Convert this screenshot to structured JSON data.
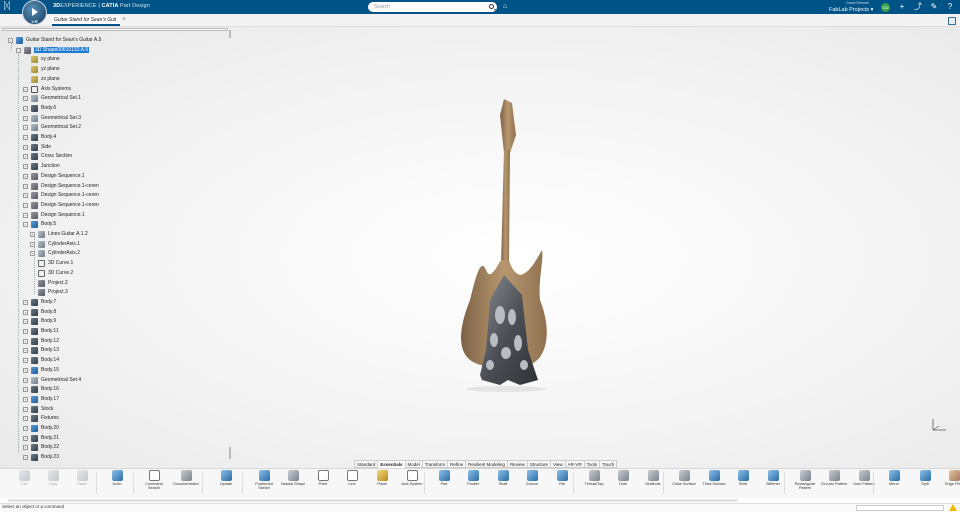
{
  "topbar": {
    "brand_bold": "3D",
    "brand_rest": "EXPERIENCE",
    "separator": " | ",
    "product": "CATIA",
    "app": " Part Design",
    "compass_version": "V.R",
    "search_placeholder": "Search",
    "user_name": "Grace Demuth",
    "workspace": "FabLab Projects",
    "workspace_chevron": "▾",
    "avatar_initials": "GD"
  },
  "tabs": {
    "active": "Guitar Stand for Sean's Guit",
    "add": "+"
  },
  "tree": {
    "root": "Guitar Stand for Sean's Guitar A.5",
    "part": "3D Shape00610133 A.5",
    "items": [
      {
        "label": "xy plane",
        "icon": "plane"
      },
      {
        "label": "yz plane",
        "icon": "plane"
      },
      {
        "label": "zx plane",
        "icon": "plane"
      },
      {
        "label": "Axis Systems",
        "icon": "axis"
      },
      {
        "label": "Geometrical Set.1",
        "icon": "geo"
      },
      {
        "label": "Body.6",
        "icon": "body"
      },
      {
        "label": "Geometrical Set.3",
        "icon": "geo"
      },
      {
        "label": "Geometrical Set.2",
        "icon": "geo"
      },
      {
        "label": "Body.4",
        "icon": "body"
      },
      {
        "label": "Side",
        "icon": "body"
      },
      {
        "label": "Cross Section",
        "icon": "body"
      },
      {
        "label": "Junction",
        "icon": "body"
      },
      {
        "label": "Design Sequence.1",
        "icon": "seq"
      },
      {
        "label": "Design Sequence.1-ceren",
        "icon": "seq"
      },
      {
        "label": "Design Sequence.1-ceren",
        "icon": "seq"
      },
      {
        "label": "Design Sequence.1-ceren",
        "icon": "seq"
      },
      {
        "label": "Design Sequence.1",
        "icon": "seq"
      },
      {
        "label": "Body.5",
        "icon": "part"
      }
    ],
    "body5_children": [
      {
        "label": "Lines Guitar A.1.2",
        "icon": "geo"
      },
      {
        "label": "CylinderAxis.1",
        "icon": "geo"
      },
      {
        "label": "CylinderAxis.2",
        "icon": "geo"
      },
      {
        "label": "3D Curve.1",
        "icon": "curve"
      },
      {
        "label": "3D Curve.2",
        "icon": "curve"
      },
      {
        "label": "Project.2",
        "icon": "seq"
      },
      {
        "label": "Project.3",
        "icon": "seq"
      }
    ],
    "items_after": [
      {
        "label": "Body.7",
        "icon": "body"
      },
      {
        "label": "Body.8",
        "icon": "body"
      },
      {
        "label": "Body.9",
        "icon": "body"
      },
      {
        "label": "Body.11",
        "icon": "body"
      },
      {
        "label": "Body.12",
        "icon": "body"
      },
      {
        "label": "Body.13",
        "icon": "body"
      },
      {
        "label": "Body.14",
        "icon": "body"
      },
      {
        "label": "Body.15",
        "icon": "part"
      },
      {
        "label": "Geometrical Set.4",
        "icon": "geo"
      },
      {
        "label": "Body.16",
        "icon": "body"
      },
      {
        "label": "Body.17",
        "icon": "part"
      },
      {
        "label": "Stock",
        "icon": "body"
      },
      {
        "label": "Fixtures",
        "icon": "body"
      },
      {
        "label": "Body.20",
        "icon": "part"
      },
      {
        "label": "Body.21",
        "icon": "body"
      },
      {
        "label": "Body.22",
        "icon": "body"
      },
      {
        "label": "Body.23",
        "icon": "body"
      }
    ]
  },
  "section_tabs": [
    "Standard",
    "Essentials",
    "Model",
    "Transform",
    "Refine",
    "Resilient Modeling",
    "Review",
    "Structure",
    "View",
    "AR-VR",
    "Tools",
    "Touch"
  ],
  "active_section": "Essentials",
  "commands": [
    {
      "label": "Cut",
      "color": "grey",
      "disabled": true
    },
    {
      "label": "Copy",
      "color": "grey",
      "disabled": true
    },
    {
      "label": "Paste",
      "color": "grey",
      "disabled": true
    },
    {
      "label": "Undo",
      "color": "blue",
      "disabled": false
    },
    {
      "label": "Command Search",
      "color": "outline",
      "disabled": false
    },
    {
      "label": "Documentation",
      "color": "grey",
      "disabled": false
    },
    {
      "label": "Update",
      "color": "blue",
      "disabled": false
    },
    {
      "label": "Positioned Sketch",
      "color": "blue",
      "disabled": false
    },
    {
      "label": "Natural Shape",
      "color": "grey",
      "disabled": false
    },
    {
      "label": "Point",
      "color": "outline",
      "disabled": false
    },
    {
      "label": "Line",
      "color": "outline",
      "disabled": false
    },
    {
      "label": "Plane",
      "color": "yellow",
      "disabled": false
    },
    {
      "label": "Axis System",
      "color": "outline",
      "disabled": false
    },
    {
      "label": "Pad",
      "color": "blue",
      "disabled": false
    },
    {
      "label": "Pocket",
      "color": "blue",
      "disabled": false
    },
    {
      "label": "Shaft",
      "color": "blue",
      "disabled": false
    },
    {
      "label": "Groove",
      "color": "blue",
      "disabled": false
    },
    {
      "label": "Rib",
      "color": "blue",
      "disabled": false
    },
    {
      "label": "Thread/Tap",
      "color": "grey",
      "disabled": false
    },
    {
      "label": "Hole",
      "color": "grey",
      "disabled": false
    },
    {
      "label": "Multihole",
      "color": "grey",
      "disabled": false
    },
    {
      "label": "Close Surface",
      "color": "grey",
      "disabled": false
    },
    {
      "label": "Thick Surface",
      "color": "blue",
      "disabled": false
    },
    {
      "label": "Shell",
      "color": "blue",
      "disabled": false
    },
    {
      "label": "Stiffener",
      "color": "blue",
      "disabled": false
    },
    {
      "label": "Rectangular Pattern",
      "color": "grey",
      "disabled": false
    },
    {
      "label": "Circular Pattern",
      "color": "grey",
      "disabled": false
    },
    {
      "label": "User Pattern",
      "color": "grey",
      "disabled": false
    },
    {
      "label": "Mirror",
      "color": "blue",
      "disabled": false
    },
    {
      "label": "Split",
      "color": "blue",
      "disabled": false
    },
    {
      "label": "Edge Fillet",
      "color": "tan",
      "disabled": false
    }
  ],
  "status": {
    "message": "Select an object or a command"
  },
  "colors": {
    "topbar": "#005386",
    "selection": "#1f7ad1",
    "guitar_body": "#a98b68",
    "stand": "#4a4d52"
  }
}
